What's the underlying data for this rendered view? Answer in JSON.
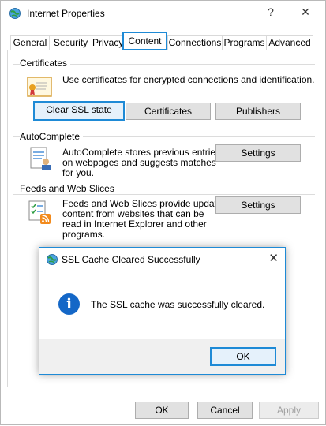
{
  "window": {
    "title": "Internet Properties",
    "help_label": "?",
    "close_label": "✕",
    "icon": "internet-globe-icon"
  },
  "tabs": [
    {
      "label": "General"
    },
    {
      "label": "Security"
    },
    {
      "label": "Privacy"
    },
    {
      "label": "Content"
    },
    {
      "label": "Connections"
    },
    {
      "label": "Programs"
    },
    {
      "label": "Advanced"
    }
  ],
  "certificates": {
    "group_label": "Certificates",
    "description": "Use certificates for encrypted connections and identification.",
    "clear_ssl_label": "Clear SSL state",
    "certificates_label": "Certificates",
    "publishers_label": "Publishers",
    "icon": "certificate-icon"
  },
  "autocomplete": {
    "group_label": "AutoComplete",
    "description_lines": [
      "AutoComplete stores previous entries",
      "on webpages and suggests matches",
      "for you."
    ],
    "settings_label": "Settings",
    "icon": "autocomplete-icon"
  },
  "feeds": {
    "group_label": "Feeds and Web Slices",
    "description_lines": [
      "Feeds and Web Slices provide updated",
      "content from websites that can be",
      "read in Internet Explorer and other",
      "programs."
    ],
    "settings_label": "Settings",
    "icon": "feeds-icon"
  },
  "dialog": {
    "title": "SSL Cache Cleared Successfully",
    "close_label": "✕",
    "message": "The SSL cache was successfully cleared.",
    "ok_label": "OK",
    "info_glyph": "i",
    "icon": "info-icon"
  },
  "footer": {
    "ok_label": "OK",
    "cancel_label": "Cancel",
    "apply_label": "Apply"
  },
  "colors": {
    "accent": "#1e8ad6",
    "info": "#1467c7"
  }
}
